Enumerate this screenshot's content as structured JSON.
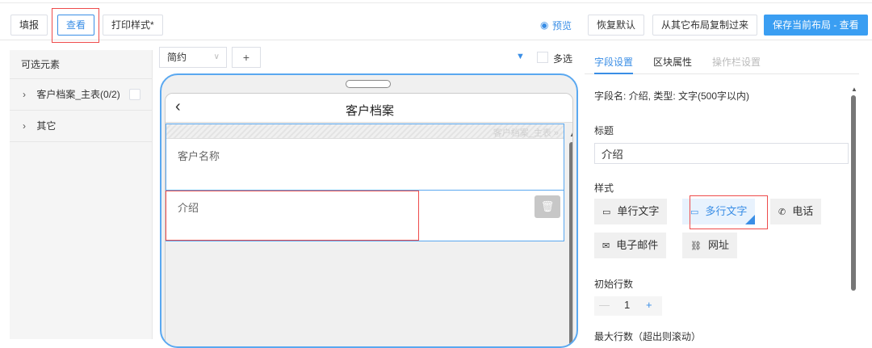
{
  "toolbar": {
    "fill_label": "填报",
    "view_label": "查看",
    "print_label": "打印样式*",
    "preview_label": "预览",
    "restore_label": "恢复默认",
    "copy_label": "从其它布局复制过来",
    "save_label": "保存当前布局 - 查看"
  },
  "left_panel": {
    "header": "可选元素",
    "items": [
      {
        "label": "客户档案_主表(0/2)"
      },
      {
        "label": "其它"
      }
    ]
  },
  "center": {
    "mode_select": "简约",
    "add_label": "+",
    "multi_label": "多选"
  },
  "phone": {
    "title": "客户档案",
    "section_label": "客户档案_主表 »",
    "fields": [
      {
        "label": "客户名称"
      },
      {
        "label": "介绍"
      }
    ]
  },
  "right_panel": {
    "tabs": [
      {
        "label": "字段设置"
      },
      {
        "label": "区块属性"
      },
      {
        "label": "操作栏设置"
      }
    ],
    "field_info": "字段名: 介绍, 类型: 文字(500字以内)",
    "title_label": "标题",
    "title_value": "介绍",
    "style_label": "样式",
    "styles": [
      {
        "label": "单行文字"
      },
      {
        "label": "多行文字"
      },
      {
        "label": "电话"
      },
      {
        "label": "电子邮件"
      },
      {
        "label": "网址"
      }
    ],
    "initial_rows_label": "初始行数",
    "initial_rows_value": "1",
    "max_rows_label": "最大行数（超出则滚动）"
  },
  "colors": {
    "accent": "#3a8ee6",
    "primary_button": "#3a9ef2",
    "highlight": "#ee4b4b"
  }
}
